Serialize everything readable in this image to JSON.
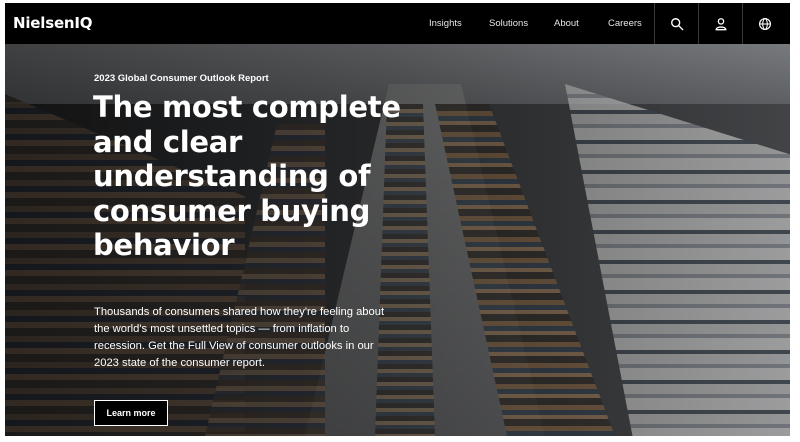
{
  "header": {
    "logo": "NielsenIQ",
    "nav": [
      {
        "label": "Insights"
      },
      {
        "label": "Solutions"
      },
      {
        "label": "About"
      },
      {
        "label": "Careers"
      }
    ],
    "icons": [
      "search-icon",
      "user-icon",
      "globe-icon"
    ]
  },
  "hero": {
    "eyebrow": "2023 Global Consumer Outlook Report",
    "headline": "The most complete and clear understanding of consumer buying behavior",
    "description": "Thousands of consumers shared how they're feeling about the world's most unsettled topics — from inflation to recession. Get the Full View of consumer outlooks in our 2023 state of the consumer report.",
    "cta_label": "Learn more"
  },
  "colors": {
    "header_bg": "#000000",
    "text": "#ffffff"
  }
}
